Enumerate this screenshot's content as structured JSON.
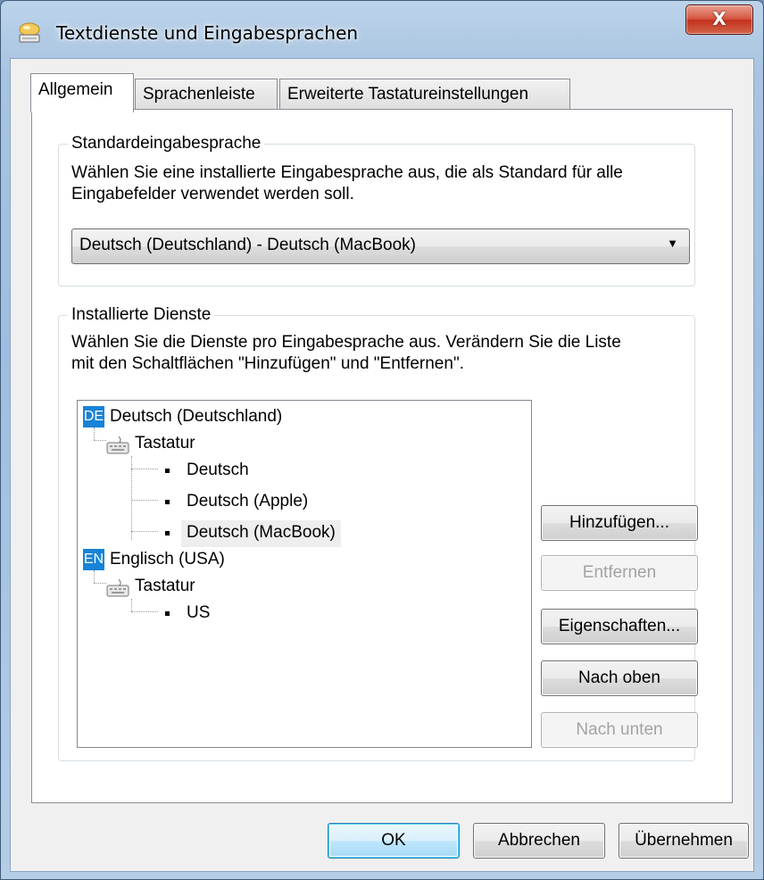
{
  "window": {
    "title": "Textdienste und Eingabesprachen",
    "close_label": "X"
  },
  "tabs": [
    {
      "label": "Allgemein"
    },
    {
      "label": "Sprachenleiste"
    },
    {
      "label": "Erweiterte Tastatureinstellungen"
    }
  ],
  "default_language": {
    "group_label": "Standardeingabesprache",
    "description_line1": "Wählen Sie eine installierte Eingabesprache aus, die als Standard für alle",
    "description_line2": "Eingabefelder verwendet werden soll.",
    "selected": "Deutsch (Deutschland) - Deutsch (MacBook)"
  },
  "installed_services": {
    "group_label": "Installierte Dienste",
    "description_line1": "Wählen Sie die Dienste pro Eingabesprache aus. Verändern Sie die Liste",
    "description_line2": "mit den Schaltflächen \"Hinzufügen\" und \"Entfernen\".",
    "tree": [
      {
        "flag": "DE",
        "label": "Deutsch (Deutschland)",
        "category": "Tastatur",
        "items": [
          "Deutsch",
          "Deutsch (Apple)",
          "Deutsch (MacBook)"
        ]
      },
      {
        "flag": "EN",
        "label": "Englisch (USA)",
        "category": "Tastatur",
        "items": [
          "US"
        ]
      }
    ],
    "selected_item": "Deutsch (MacBook)",
    "buttons": {
      "add": "Hinzufügen...",
      "remove": "Entfernen",
      "properties": "Eigenschaften...",
      "move_up": "Nach oben",
      "move_down": "Nach unten"
    }
  },
  "footer": {
    "ok": "OK",
    "cancel": "Abbrechen",
    "apply": "Übernehmen"
  }
}
